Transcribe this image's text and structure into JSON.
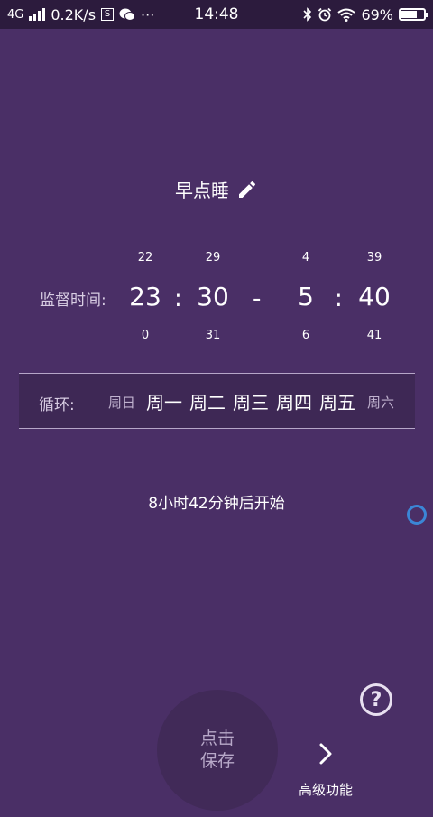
{
  "status_bar": {
    "network": "4G",
    "speed": "0.2K/s",
    "sim_icon": "S",
    "more": "···",
    "time": "14:48",
    "battery": "69%",
    "battery_level": 0.69
  },
  "header": {
    "title": "早点睡",
    "edit_icon": "pencil-icon"
  },
  "monitor": {
    "label": "监督时间:",
    "start_hour": {
      "prev": "22",
      "current": "23",
      "next": "0"
    },
    "start_minute": {
      "prev": "29",
      "current": "30",
      "next": "31"
    },
    "end_hour": {
      "prev": "4",
      "current": "5",
      "next": "6"
    },
    "end_minute": {
      "prev": "39",
      "current": "40",
      "next": "41"
    },
    "colon": ":",
    "dash": "-"
  },
  "repeat": {
    "label": "循环:",
    "days": [
      {
        "label": "周日",
        "active": false
      },
      {
        "label": "周一",
        "active": true
      },
      {
        "label": "周二",
        "active": true
      },
      {
        "label": "周三",
        "active": true
      },
      {
        "label": "周四",
        "active": true
      },
      {
        "label": "周五",
        "active": true
      },
      {
        "label": "周六",
        "active": false
      }
    ]
  },
  "countdown": "8小时42分钟后开始",
  "help_label": "?",
  "save_button": {
    "line1": "点击",
    "line2": "保存"
  },
  "advanced": {
    "label": "高级功能",
    "icon": "chevron-right-icon"
  },
  "colors": {
    "background": "#4a2f66",
    "status_bar": "#2c1b3d",
    "float_ring": "#3b86d6"
  }
}
